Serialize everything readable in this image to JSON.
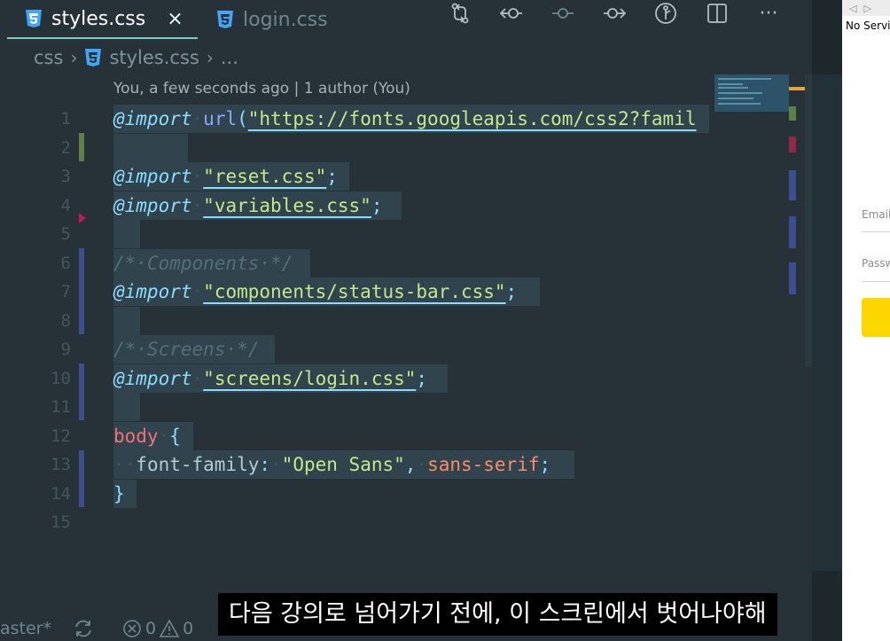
{
  "tabs": [
    {
      "label": "styles.css",
      "active": true,
      "close": "×"
    },
    {
      "label": "login.css",
      "active": false
    }
  ],
  "toolbar_icons": [
    "source-control-icon",
    "go-back-icon",
    "commit-icon",
    "go-forward-icon",
    "timeline-icon",
    "split-editor-icon",
    "more-icon"
  ],
  "toolbar_more": "···",
  "breadcrumb": {
    "folder": "css",
    "file": "styles.css",
    "more": "..."
  },
  "blame": "You, a few seconds ago | 1 author (You)",
  "line_numbers": [
    "1",
    "2",
    "3",
    "4",
    "5",
    "6",
    "7",
    "8",
    "9",
    "10",
    "11",
    "12",
    "13",
    "14",
    "15"
  ],
  "code": {
    "l1_kw": "@import",
    "l1_fn": "url",
    "l1_open": "(",
    "l1_url": "\"https://fonts.googleapis.com/css2?famil",
    "l3_kw": "@import",
    "l3_str": "\"reset.css\"",
    "l3_semi": ";",
    "l4_kw": "@import",
    "l4_str": "\"variables.css\"",
    "l4_semi": ";",
    "l6_comment": "/*·Components·*/",
    "l7_kw": "@import",
    "l7_str": "\"components/status-bar.css\"",
    "l7_semi": ";",
    "l9_comment": "/*·Screens·*/",
    "l10_kw": "@import",
    "l10_str": "\"screens/login.css\"",
    "l10_semi": ";",
    "l12_sel": "body",
    "l12_brace": "{",
    "l13_indent": "··",
    "l13_prop": "font-family",
    "l13_colon": ":",
    "l13_str": "\"Open Sans\"",
    "l13_comma": ",",
    "l13_val": "sans-serif",
    "l13_semi": ";",
    "l14_brace": "}"
  },
  "simulator": {
    "status": "No Service",
    "email_label": "Email",
    "password_label": "Password",
    "button_color": "#fdd600"
  },
  "statusbar": {
    "branch": "aster*",
    "errors": "0",
    "warnings": "0"
  },
  "subtitle": "다음 강의로 넘어가기 전에, 이 스크린에서 벗어나야해",
  "colors": {
    "background": "#263238",
    "keyword": "#89ddff",
    "string": "#c3e88d",
    "selector": "#f07178",
    "comment": "#546e7a",
    "active_tab_border": "#80cbc4"
  }
}
